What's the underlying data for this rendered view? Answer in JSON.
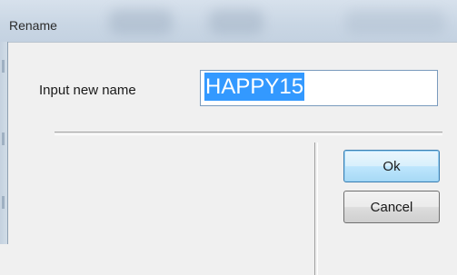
{
  "window": {
    "title": "Rename"
  },
  "form": {
    "label": "Input new name",
    "name_value": "HAPPY15"
  },
  "buttons": {
    "ok_label": "Ok",
    "cancel_label": "Cancel"
  },
  "colors": {
    "selection": "#3399ff",
    "titlebar": "#c9d6e4",
    "default_button_border": "#3c7fb1"
  }
}
